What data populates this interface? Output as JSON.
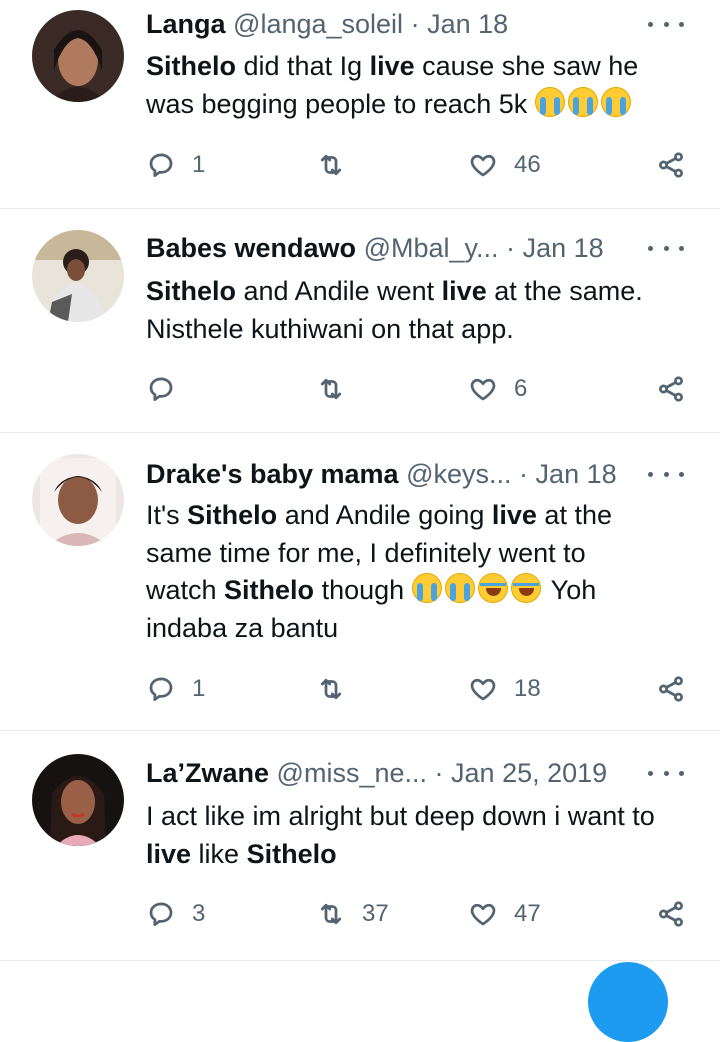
{
  "tweets": [
    {
      "name": "Langa",
      "handle": "@langa_soleil",
      "dot": "·",
      "date": "Jan 18",
      "lines": [
        [
          {
            "t": "Sithelo",
            "b": true
          },
          {
            "t": " did that Ig "
          },
          {
            "t": "live",
            "b": true
          },
          {
            "t": "  cause she saw he"
          }
        ],
        [
          {
            "t": "was begging people to reach 5k "
          },
          {
            "e": "cry"
          },
          {
            "e": "cry"
          },
          {
            "e": "cry"
          }
        ]
      ],
      "replies": "1",
      "retweets": "",
      "likes": "46"
    },
    {
      "name": "Babes wendawo",
      "handle": "@Mbal_y...",
      "dot": " ·",
      "date": "Jan 18",
      "lines": [
        [
          {
            "t": "Sithelo",
            "b": true
          },
          {
            "t": " and Andile went "
          },
          {
            "t": "live",
            "b": true
          },
          {
            "t": " at the same."
          }
        ],
        [
          {
            "t": "Nisthele kuthiwani on that app."
          }
        ]
      ],
      "replies": "",
      "retweets": "",
      "likes": "6"
    },
    {
      "name": "Drake's baby mama",
      "handle": "@keys...",
      "dot": "·",
      "date": "Jan 18",
      "lines": [
        [
          {
            "t": "It's "
          },
          {
            "t": "Sithelo",
            "b": true
          },
          {
            "t": " and Andile going "
          },
          {
            "t": "live",
            "b": true
          },
          {
            "t": " at the"
          }
        ],
        [
          {
            "t": "same time for me, I definitely went to"
          }
        ],
        [
          {
            "t": "watch "
          },
          {
            "t": "Sithelo",
            "b": true
          },
          {
            "t": " though "
          },
          {
            "e": "cry"
          },
          {
            "e": "cry"
          },
          {
            "e": "laugh"
          },
          {
            "e": "laugh"
          },
          {
            "t": " Yoh"
          }
        ],
        [
          {
            "t": "indaba za bantu"
          }
        ]
      ],
      "replies": "1",
      "retweets": "",
      "likes": "18"
    },
    {
      "name": "La’Zwane",
      "handle": "@miss_ne...",
      "dot": " ·",
      "date": "Jan 25, 2019",
      "lines": [
        [
          {
            "t": "I act like im alright but deep down i want to"
          }
        ],
        [
          {
            "t": "live",
            "b": true
          },
          {
            "t": " like "
          },
          {
            "t": "Sithelo",
            "b": true
          }
        ]
      ],
      "replies": "3",
      "retweets": "37",
      "likes": "47"
    }
  ],
  "icons": {
    "reply": "reply-icon",
    "retweet": "retweet-icon",
    "like": "heart-icon",
    "share": "share-icon",
    "more": "more-options-icon"
  },
  "colors": {
    "text": "#0f1419",
    "secondary": "#536471",
    "divider": "#e6ecf0",
    "accent": "#1d9bf0"
  }
}
